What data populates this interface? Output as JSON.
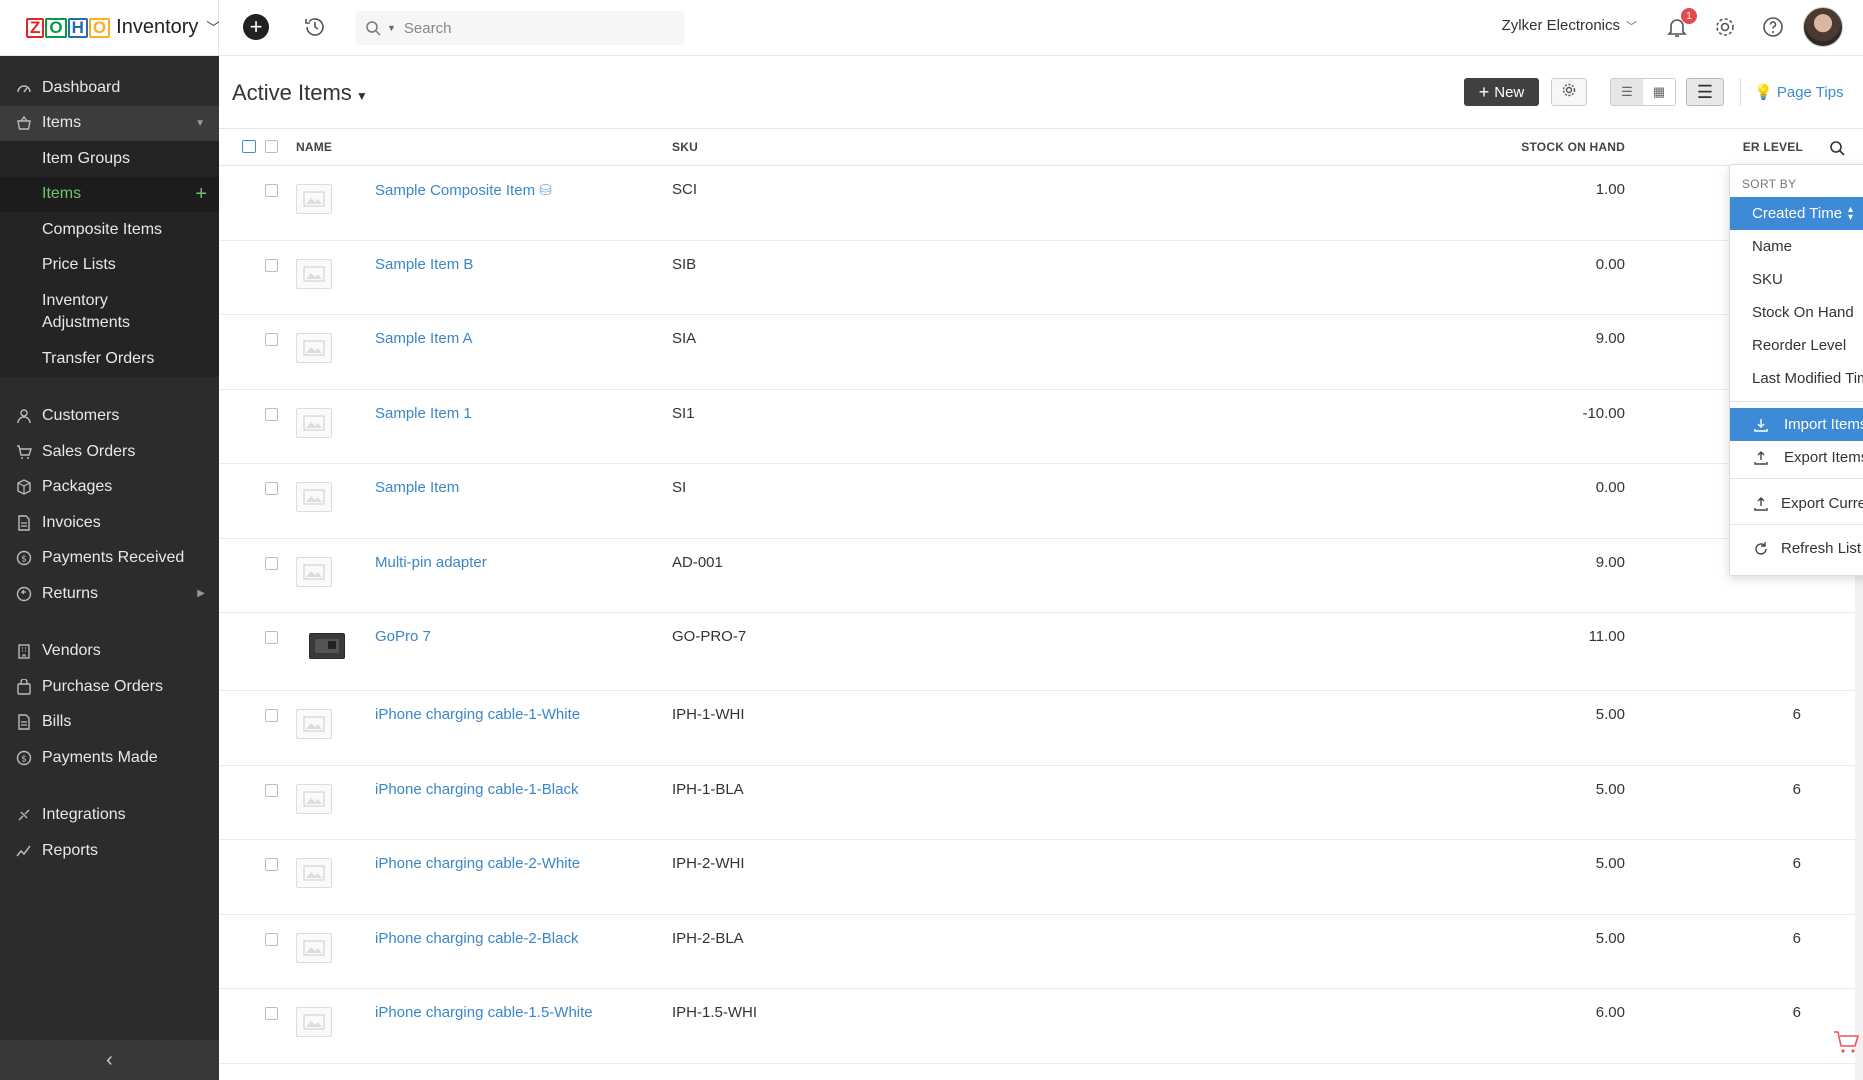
{
  "brand": {
    "logo_text": [
      "Z",
      "O",
      "H",
      "O"
    ],
    "app_name": "Inventory"
  },
  "sidebar": {
    "items": [
      {
        "label": "Dashboard",
        "icon": "dashboard-icon"
      },
      {
        "label": "Items",
        "icon": "basket-icon"
      },
      {
        "label": "Item Groups"
      },
      {
        "label": "Items"
      },
      {
        "label": "Composite Items"
      },
      {
        "label": "Price Lists"
      },
      {
        "label": "Inventory\nAdjustments"
      },
      {
        "label": "Transfer Orders"
      },
      {
        "label": "Customers",
        "icon": "person-icon"
      },
      {
        "label": "Sales Orders",
        "icon": "cart-icon"
      },
      {
        "label": "Packages",
        "icon": "package-icon"
      },
      {
        "label": "Invoices",
        "icon": "document-icon"
      },
      {
        "label": "Payments Received",
        "icon": "money-icon"
      },
      {
        "label": "Returns",
        "icon": "return-icon"
      },
      {
        "label": "Vendors",
        "icon": "building-icon"
      },
      {
        "label": "Purchase Orders",
        "icon": "bag-icon"
      },
      {
        "label": "Bills",
        "icon": "document-icon"
      },
      {
        "label": "Payments Made",
        "icon": "money-icon"
      },
      {
        "label": "Integrations",
        "icon": "integrations-icon"
      },
      {
        "label": "Reports",
        "icon": "chart-icon"
      }
    ]
  },
  "topbar": {
    "search_placeholder": "Search",
    "org_name": "Zylker Electronics",
    "notification_count": "1"
  },
  "header": {
    "title": "Active Items",
    "new_label": "New",
    "page_tips": "Page Tips"
  },
  "table": {
    "columns": {
      "name": "NAME",
      "sku": "SKU",
      "stock": "STOCK ON HAND",
      "reorder": "ER LEVEL"
    },
    "rows": [
      {
        "name": "Sample Composite Item",
        "sku": "SCI",
        "stock": "1.00",
        "reorder": ""
      },
      {
        "name": "Sample Item B",
        "sku": "SIB",
        "stock": "0.00",
        "reorder": ""
      },
      {
        "name": "Sample Item A",
        "sku": "SIA",
        "stock": "9.00",
        "reorder": ""
      },
      {
        "name": "Sample Item 1",
        "sku": "SI1",
        "stock": "-10.00",
        "reorder": ""
      },
      {
        "name": "Sample Item",
        "sku": "SI",
        "stock": "0.00",
        "reorder": ""
      },
      {
        "name": "Multi-pin adapter",
        "sku": "AD-001",
        "stock": "9.00",
        "reorder": ""
      },
      {
        "name": "GoPro 7",
        "sku": "GO-PRO-7",
        "stock": "11.00",
        "reorder": ""
      },
      {
        "name": "iPhone charging cable-1-White",
        "sku": "IPH-1-WHI",
        "stock": "5.00",
        "reorder": "6"
      },
      {
        "name": "iPhone charging cable-1-Black",
        "sku": "IPH-1-BLA",
        "stock": "5.00",
        "reorder": "6"
      },
      {
        "name": "iPhone charging cable-2-White",
        "sku": "IPH-2-WHI",
        "stock": "5.00",
        "reorder": "6"
      },
      {
        "name": "iPhone charging cable-2-Black",
        "sku": "IPH-2-BLA",
        "stock": "5.00",
        "reorder": "6"
      },
      {
        "name": "iPhone charging cable-1.5-White",
        "sku": "IPH-1.5-WHI",
        "stock": "6.00",
        "reorder": "6"
      }
    ]
  },
  "dropdown": {
    "caption": "SORT BY",
    "sort_options": [
      "Created Time",
      "Name",
      "SKU",
      "Stock On Hand",
      "Reorder Level",
      "Last Modified Time"
    ],
    "import_label": "Import Items",
    "export_label": "Export Items",
    "export_view_label": "Export Current View",
    "refresh_label": "Refresh List"
  },
  "colors": {
    "accent": "#3d8ad6",
    "sidebar_bg": "#2c2c2e",
    "active_green": "#72c372"
  }
}
